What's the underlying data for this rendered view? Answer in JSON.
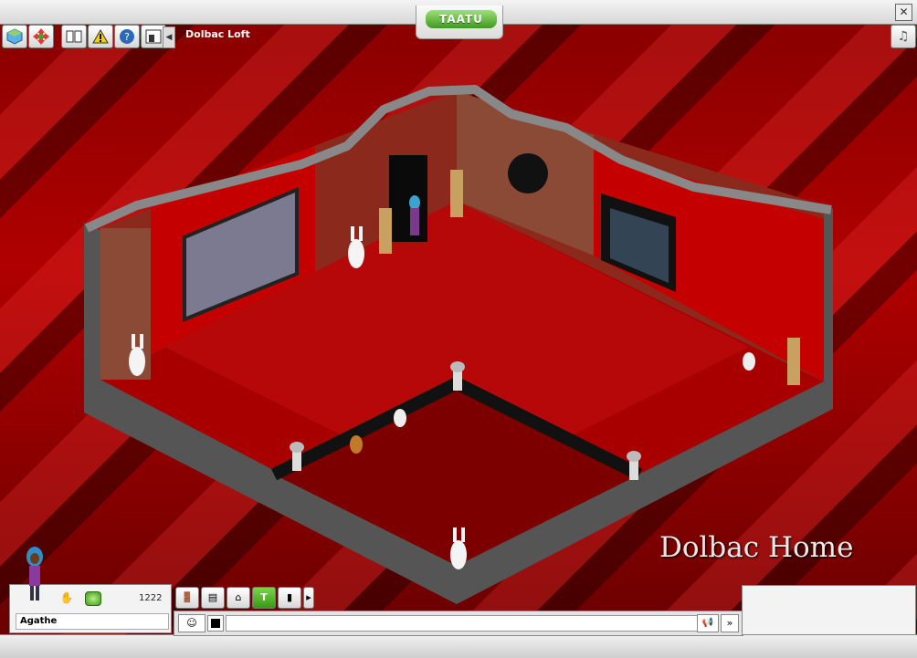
{
  "window": {
    "brand": "TAATU",
    "close_glyph": "✕"
  },
  "toolbar": {
    "items": [
      {
        "icon": "globe-icon"
      },
      {
        "icon": "move-arrows-icon"
      },
      {
        "icon": "book-icon"
      },
      {
        "icon": "warning-icon"
      },
      {
        "icon": "help-icon"
      },
      {
        "icon": "room-settings-icon"
      }
    ]
  },
  "room": {
    "name": "Dolbac Loft",
    "label": "Dolbac Home"
  },
  "music_glyph": "♫",
  "user": {
    "name": "Agathe",
    "coins": "1222"
  },
  "bottom_tabs": [
    {
      "icon": "door-icon"
    },
    {
      "icon": "id-card-icon"
    },
    {
      "icon": "home-icon"
    },
    {
      "icon": "trade-icon"
    },
    {
      "icon": "jar-icon"
    }
  ],
  "chat": {
    "input_value": "",
    "send_glyph": "»"
  },
  "colors": {
    "floor": "#b00000",
    "wall": "#6d6d6d",
    "curtain": "#c40000"
  }
}
